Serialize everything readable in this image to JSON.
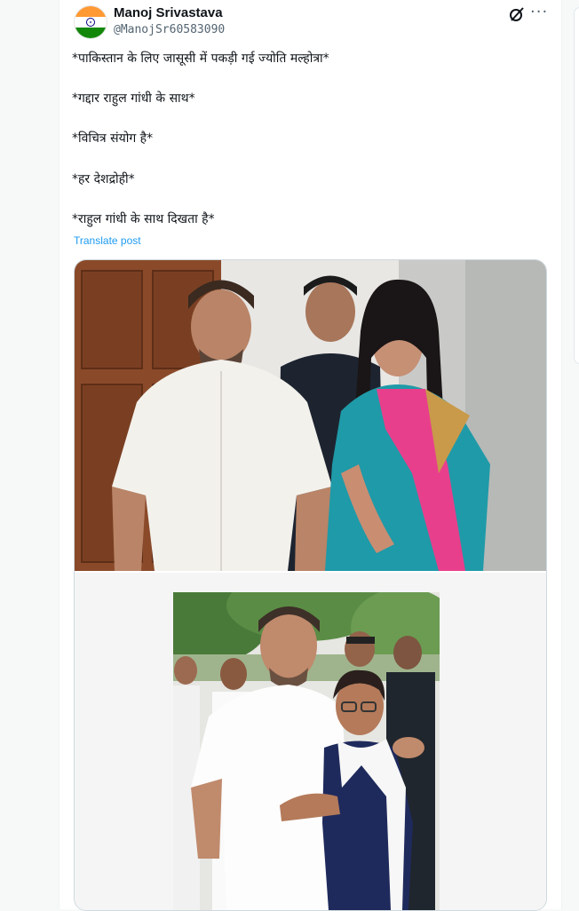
{
  "tweet": {
    "author_name": "Manoj Srivastava",
    "handle": "@ManojSr60583090",
    "lines": [
      "*पाकिस्तान के लिए जासूसी में पकड़ी गई ज्योति मल्होत्रा*",
      "*गद्दार राहुल गांधी के साथ*",
      "*विचित्र संयोग है*",
      "*हर देशद्रोही*",
      "*राहुल गांधी के साथ दिखता है*"
    ],
    "translate_label": "Translate post"
  },
  "icons": {
    "avatar": "india-flag-avatar",
    "grok": "grok-icon",
    "more": "more-options-icon"
  },
  "colors": {
    "link": "#1d9bf0",
    "text": "#0f1419",
    "muted": "#536471"
  }
}
